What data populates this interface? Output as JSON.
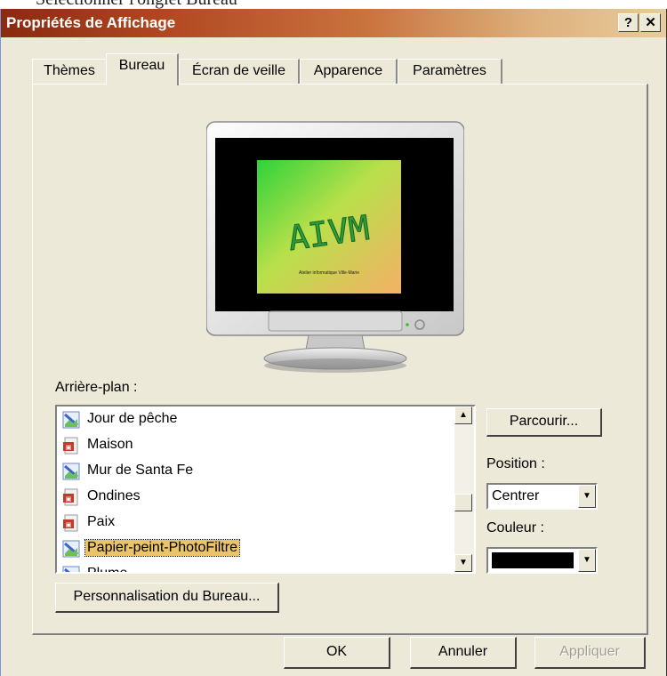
{
  "caption": "Sélectionner l'onglet Bureau",
  "window": {
    "title": "Propriétés de Affichage",
    "help_label": "?",
    "close_label": "✕"
  },
  "tabs": [
    {
      "label": "Thèmes"
    },
    {
      "label": "Bureau"
    },
    {
      "label": "Écran de veille"
    },
    {
      "label": "Apparence"
    },
    {
      "label": "Paramètres"
    }
  ],
  "active_tab": "Bureau",
  "preview": {
    "wallpaper_title": "AIVM",
    "wallpaper_subtitle": "Atelier informatique Ville-Marie"
  },
  "background": {
    "label": "Arrière-plan :",
    "items": [
      {
        "label": "Jour de pêche",
        "icon": "image-icon"
      },
      {
        "label": "Maison",
        "icon": "document-icon"
      },
      {
        "label": "Mur de Santa Fe",
        "icon": "image-icon"
      },
      {
        "label": "Ondines",
        "icon": "document-icon"
      },
      {
        "label": "Paix",
        "icon": "document-icon"
      },
      {
        "label": "Papier-peint-PhotoFiltre",
        "icon": "image-icon",
        "selected": true
      },
      {
        "label": "Plume",
        "icon": "image-icon"
      }
    ]
  },
  "browse_label": "Parcourir...",
  "position": {
    "label": "Position :",
    "value": "Centrer"
  },
  "color": {
    "label": "Couleur :",
    "value": "#000000"
  },
  "customize_label": "Personnalisation du Bureau...",
  "footer": {
    "ok_label": "OK",
    "cancel_label": "Annuler",
    "apply_label": "Appliquer"
  }
}
